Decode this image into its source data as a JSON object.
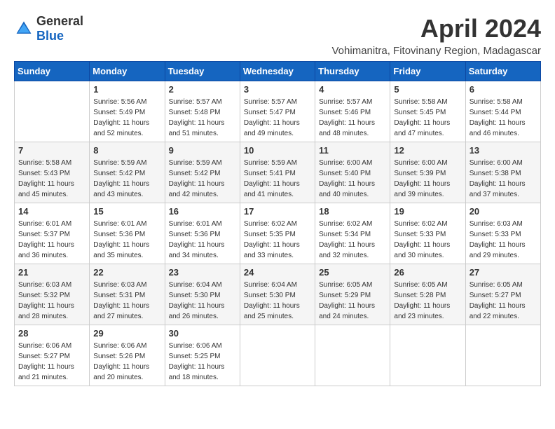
{
  "logo": {
    "general": "General",
    "blue": "Blue"
  },
  "title": "April 2024",
  "subtitle": "Vohimanitra, Fitovinany Region, Madagascar",
  "headers": [
    "Sunday",
    "Monday",
    "Tuesday",
    "Wednesday",
    "Thursday",
    "Friday",
    "Saturday"
  ],
  "weeks": [
    [
      {
        "day": "",
        "sunrise": "",
        "sunset": "",
        "daylight": ""
      },
      {
        "day": "1",
        "sunrise": "Sunrise: 5:56 AM",
        "sunset": "Sunset: 5:49 PM",
        "daylight": "Daylight: 11 hours and 52 minutes."
      },
      {
        "day": "2",
        "sunrise": "Sunrise: 5:57 AM",
        "sunset": "Sunset: 5:48 PM",
        "daylight": "Daylight: 11 hours and 51 minutes."
      },
      {
        "day": "3",
        "sunrise": "Sunrise: 5:57 AM",
        "sunset": "Sunset: 5:47 PM",
        "daylight": "Daylight: 11 hours and 49 minutes."
      },
      {
        "day": "4",
        "sunrise": "Sunrise: 5:57 AM",
        "sunset": "Sunset: 5:46 PM",
        "daylight": "Daylight: 11 hours and 48 minutes."
      },
      {
        "day": "5",
        "sunrise": "Sunrise: 5:58 AM",
        "sunset": "Sunset: 5:45 PM",
        "daylight": "Daylight: 11 hours and 47 minutes."
      },
      {
        "day": "6",
        "sunrise": "Sunrise: 5:58 AM",
        "sunset": "Sunset: 5:44 PM",
        "daylight": "Daylight: 11 hours and 46 minutes."
      }
    ],
    [
      {
        "day": "7",
        "sunrise": "Sunrise: 5:58 AM",
        "sunset": "Sunset: 5:43 PM",
        "daylight": "Daylight: 11 hours and 45 minutes."
      },
      {
        "day": "8",
        "sunrise": "Sunrise: 5:59 AM",
        "sunset": "Sunset: 5:42 PM",
        "daylight": "Daylight: 11 hours and 43 minutes."
      },
      {
        "day": "9",
        "sunrise": "Sunrise: 5:59 AM",
        "sunset": "Sunset: 5:42 PM",
        "daylight": "Daylight: 11 hours and 42 minutes."
      },
      {
        "day": "10",
        "sunrise": "Sunrise: 5:59 AM",
        "sunset": "Sunset: 5:41 PM",
        "daylight": "Daylight: 11 hours and 41 minutes."
      },
      {
        "day": "11",
        "sunrise": "Sunrise: 6:00 AM",
        "sunset": "Sunset: 5:40 PM",
        "daylight": "Daylight: 11 hours and 40 minutes."
      },
      {
        "day": "12",
        "sunrise": "Sunrise: 6:00 AM",
        "sunset": "Sunset: 5:39 PM",
        "daylight": "Daylight: 11 hours and 39 minutes."
      },
      {
        "day": "13",
        "sunrise": "Sunrise: 6:00 AM",
        "sunset": "Sunset: 5:38 PM",
        "daylight": "Daylight: 11 hours and 37 minutes."
      }
    ],
    [
      {
        "day": "14",
        "sunrise": "Sunrise: 6:01 AM",
        "sunset": "Sunset: 5:37 PM",
        "daylight": "Daylight: 11 hours and 36 minutes."
      },
      {
        "day": "15",
        "sunrise": "Sunrise: 6:01 AM",
        "sunset": "Sunset: 5:36 PM",
        "daylight": "Daylight: 11 hours and 35 minutes."
      },
      {
        "day": "16",
        "sunrise": "Sunrise: 6:01 AM",
        "sunset": "Sunset: 5:36 PM",
        "daylight": "Daylight: 11 hours and 34 minutes."
      },
      {
        "day": "17",
        "sunrise": "Sunrise: 6:02 AM",
        "sunset": "Sunset: 5:35 PM",
        "daylight": "Daylight: 11 hours and 33 minutes."
      },
      {
        "day": "18",
        "sunrise": "Sunrise: 6:02 AM",
        "sunset": "Sunset: 5:34 PM",
        "daylight": "Daylight: 11 hours and 32 minutes."
      },
      {
        "day": "19",
        "sunrise": "Sunrise: 6:02 AM",
        "sunset": "Sunset: 5:33 PM",
        "daylight": "Daylight: 11 hours and 30 minutes."
      },
      {
        "day": "20",
        "sunrise": "Sunrise: 6:03 AM",
        "sunset": "Sunset: 5:33 PM",
        "daylight": "Daylight: 11 hours and 29 minutes."
      }
    ],
    [
      {
        "day": "21",
        "sunrise": "Sunrise: 6:03 AM",
        "sunset": "Sunset: 5:32 PM",
        "daylight": "Daylight: 11 hours and 28 minutes."
      },
      {
        "day": "22",
        "sunrise": "Sunrise: 6:03 AM",
        "sunset": "Sunset: 5:31 PM",
        "daylight": "Daylight: 11 hours and 27 minutes."
      },
      {
        "day": "23",
        "sunrise": "Sunrise: 6:04 AM",
        "sunset": "Sunset: 5:30 PM",
        "daylight": "Daylight: 11 hours and 26 minutes."
      },
      {
        "day": "24",
        "sunrise": "Sunrise: 6:04 AM",
        "sunset": "Sunset: 5:30 PM",
        "daylight": "Daylight: 11 hours and 25 minutes."
      },
      {
        "day": "25",
        "sunrise": "Sunrise: 6:05 AM",
        "sunset": "Sunset: 5:29 PM",
        "daylight": "Daylight: 11 hours and 24 minutes."
      },
      {
        "day": "26",
        "sunrise": "Sunrise: 6:05 AM",
        "sunset": "Sunset: 5:28 PM",
        "daylight": "Daylight: 11 hours and 23 minutes."
      },
      {
        "day": "27",
        "sunrise": "Sunrise: 6:05 AM",
        "sunset": "Sunset: 5:27 PM",
        "daylight": "Daylight: 11 hours and 22 minutes."
      }
    ],
    [
      {
        "day": "28",
        "sunrise": "Sunrise: 6:06 AM",
        "sunset": "Sunset: 5:27 PM",
        "daylight": "Daylight: 11 hours and 21 minutes."
      },
      {
        "day": "29",
        "sunrise": "Sunrise: 6:06 AM",
        "sunset": "Sunset: 5:26 PM",
        "daylight": "Daylight: 11 hours and 20 minutes."
      },
      {
        "day": "30",
        "sunrise": "Sunrise: 6:06 AM",
        "sunset": "Sunset: 5:25 PM",
        "daylight": "Daylight: 11 hours and 18 minutes."
      },
      {
        "day": "",
        "sunrise": "",
        "sunset": "",
        "daylight": ""
      },
      {
        "day": "",
        "sunrise": "",
        "sunset": "",
        "daylight": ""
      },
      {
        "day": "",
        "sunrise": "",
        "sunset": "",
        "daylight": ""
      },
      {
        "day": "",
        "sunrise": "",
        "sunset": "",
        "daylight": ""
      }
    ]
  ]
}
